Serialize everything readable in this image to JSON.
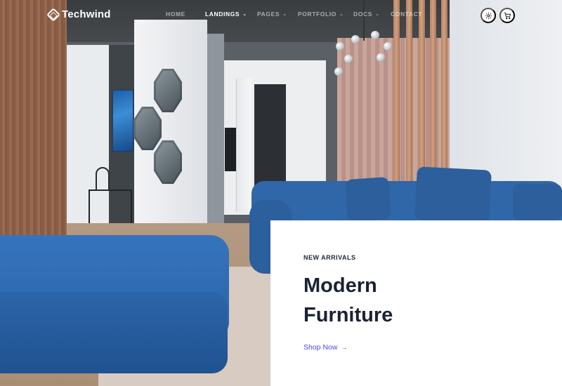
{
  "brand": {
    "name": "Techwind",
    "logo_icon": "techwind-logo-icon"
  },
  "nav": {
    "items": [
      {
        "label": "HOME",
        "has_dropdown": false,
        "active": false
      },
      {
        "label": "LANDINGS",
        "has_dropdown": true,
        "active": true
      },
      {
        "label": "PAGES",
        "has_dropdown": true,
        "active": false
      },
      {
        "label": "PORTFOLIO",
        "has_dropdown": true,
        "active": false
      },
      {
        "label": "DOCS",
        "has_dropdown": true,
        "active": false
      },
      {
        "label": "CONTACT",
        "has_dropdown": false,
        "active": false
      }
    ],
    "actions": [
      {
        "icon": "settings-icon",
        "glyph": "⚙"
      },
      {
        "icon": "cart-icon",
        "glyph": "🛒"
      }
    ]
  },
  "hero": {
    "eyebrow": "NEW ARRIVALS",
    "title_line1": "Modern",
    "title_line2": "Furniture",
    "cta_label": "Shop Now",
    "cta_arrow": "→"
  },
  "colors": {
    "accent": "#4f46e5",
    "heading": "#1b2133",
    "sofa_blue": "#2f67a8",
    "card_bg": "#ffffff"
  }
}
